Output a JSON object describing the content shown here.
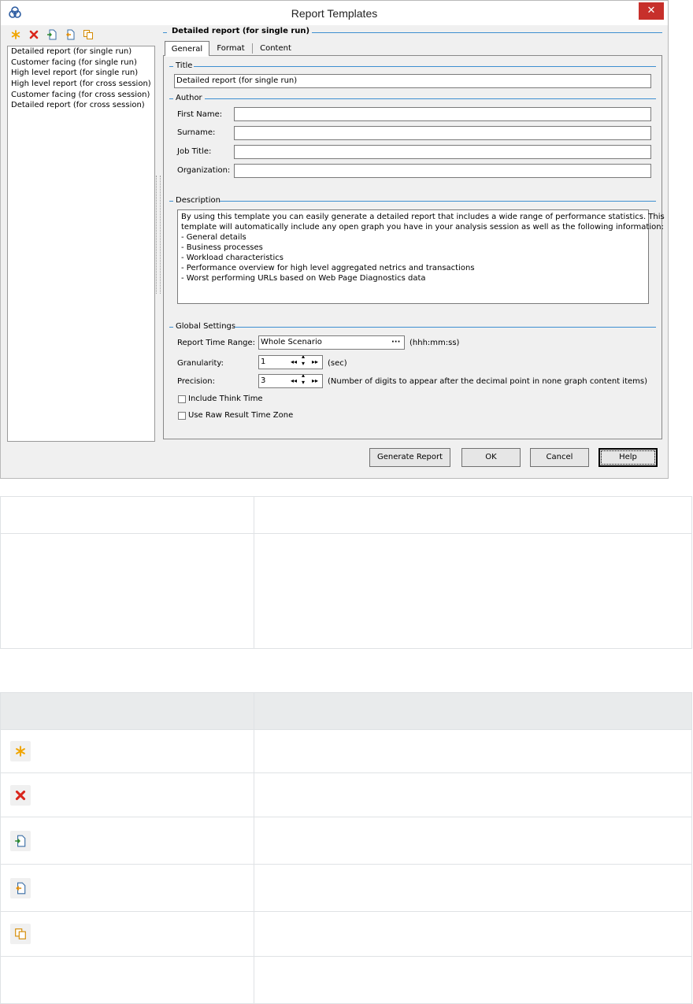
{
  "window": {
    "title": "Report Templates",
    "close_glyph": "✕",
    "app_icon": "report-templates-icon"
  },
  "toolbar": {
    "icons": [
      "new-template-icon",
      "delete-template-icon",
      "import-template-icon",
      "export-template-icon",
      "duplicate-template-icon"
    ]
  },
  "templates": [
    "Detailed report (for single run)",
    "Customer facing (for single run)",
    "High level report (for single run)",
    "High level report (for cross session)",
    "Customer facing (for cross session)",
    "Detailed report (for cross session)"
  ],
  "panel_header": "Detailed report (for single run)",
  "tabs": [
    "General",
    "Format",
    "Content"
  ],
  "active_tab": "General",
  "general": {
    "title_group": "Title",
    "title_value": "Detailed report (for single run)",
    "author_group": "Author",
    "first_name_label": "First Name:",
    "first_name_value": "",
    "surname_label": "Surname:",
    "surname_value": "",
    "job_title_label": "Job Title:",
    "job_title_value": "",
    "organization_label": "Organization:",
    "organization_value": "",
    "description_group": "Description",
    "description_lines": [
      "By using this template you can easily generate a detailed report that includes a wide range of performance statistics. This",
      "template will automatically include any open graph you have in your analysis session as well as the following information:",
      "- General details",
      "- Business processes",
      "- Workload characteristics",
      "- Performance overview for high level aggregated netrics and transactions",
      "- Worst performing URLs based on Web Page Diagnostics data"
    ],
    "global_group": "Global Settings",
    "time_range_label": "Report Time Range:",
    "time_range_value": "Whole Scenario",
    "time_range_button": "···",
    "time_range_unit": "(hhh:mm:ss)",
    "granularity_label": "Granularity:",
    "granularity_value": "1",
    "granularity_unit": "(sec)",
    "precision_label": "Precision:",
    "precision_value": "3",
    "precision_unit": "(Number of digits to appear after the decimal point in none graph content items)",
    "think_time_label": "Include Think Time",
    "think_time_checked": false,
    "raw_tz_label": "Use Raw Result Time Zone",
    "raw_tz_checked": false
  },
  "buttons": {
    "generate": "Generate Report",
    "ok": "OK",
    "cancel": "Cancel",
    "help": "Help"
  },
  "icon_table": {
    "rows": [
      "new-template-icon",
      "delete-template-icon",
      "import-template-icon",
      "export-template-icon",
      "duplicate-template-icon"
    ]
  }
}
